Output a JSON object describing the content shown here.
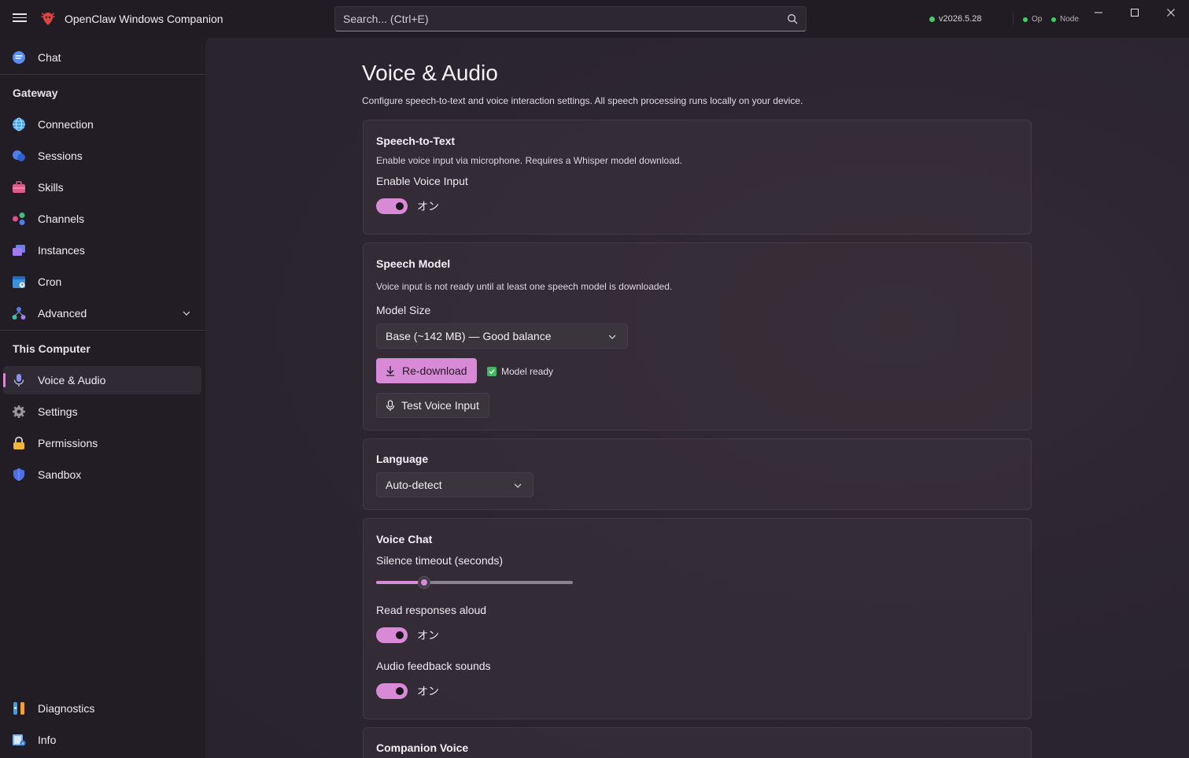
{
  "app": {
    "title": "OpenClaw Windows Companion",
    "version": "v2026.5.28",
    "status_op": "Op",
    "status_node": "Node"
  },
  "search": {
    "placeholder": "Search... (Ctrl+E)"
  },
  "sidebar": {
    "chat": "Chat",
    "gateway_header": "Gateway",
    "gateway_items": [
      "Connection",
      "Sessions",
      "Skills",
      "Channels",
      "Instances",
      "Cron",
      "Advanced"
    ],
    "computer_header": "This Computer",
    "computer_items": [
      "Voice & Audio",
      "Settings",
      "Permissions",
      "Sandbox"
    ],
    "bottom_items": [
      "Diagnostics",
      "Info"
    ]
  },
  "page": {
    "title": "Voice & Audio",
    "subtitle": "Configure speech-to-text and voice interaction settings. All speech processing runs locally on your device."
  },
  "stt": {
    "title": "Speech-to-Text",
    "desc": "Enable voice input via microphone. Requires a Whisper model download.",
    "enable_label": "Enable Voice Input",
    "enable_state": "オン"
  },
  "model": {
    "title": "Speech Model",
    "desc": "Voice input is not ready until at least one speech model is downloaded.",
    "size_label": "Model Size",
    "size_value": "Base (~142 MB) — Good balance",
    "redownload": "Re-download",
    "ready_text": "Model ready",
    "test": "Test Voice Input"
  },
  "language": {
    "title": "Language",
    "value": "Auto-detect"
  },
  "voice_chat": {
    "title": "Voice Chat",
    "silence_label": "Silence timeout (seconds)",
    "silence_fraction": 0.245,
    "read_label": "Read responses aloud",
    "read_state": "オン",
    "feedback_label": "Audio feedback sounds",
    "feedback_state": "オン"
  },
  "companion": {
    "title": "Companion Voice"
  },
  "colors": {
    "accent": "#d98ad6",
    "status_green": "#3fcf5e"
  }
}
